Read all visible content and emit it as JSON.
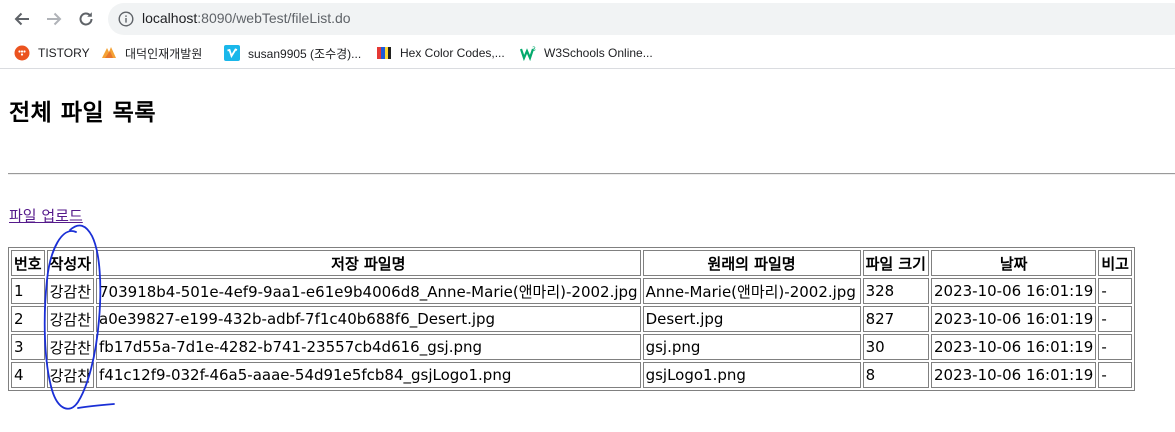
{
  "browser": {
    "url_host": "localhost",
    "url_rest": ":8090/webTest/fileList.do",
    "bookmarks": [
      {
        "label": "TISTORY",
        "icon": "tistory-icon"
      },
      {
        "label": "대덕인재개발원",
        "icon": "ddit-icon"
      },
      {
        "label": "susan9905 (조수경)...",
        "icon": "vimeo-icon"
      },
      {
        "label": "Hex Color Codes,...",
        "icon": "color-book-icon"
      },
      {
        "label": "W3Schools Online...",
        "icon": "w3schools-icon"
      }
    ]
  },
  "page": {
    "title": "전체 파일 목록",
    "upload_link": "파일 업로드",
    "table": {
      "headers": [
        "번호",
        "작성자",
        "저장 파일명",
        "원래의 파일명",
        "파일 크기",
        "날짜",
        "비고"
      ],
      "rows": [
        [
          "1",
          "강감찬",
          "703918b4-501e-4ef9-9aa1-e61e9b4006d8_Anne-Marie(앤마리)-2002.jpg",
          "Anne-Marie(앤마리)-2002.jpg",
          "328",
          "2023-10-06 16:01:19",
          "-"
        ],
        [
          "2",
          "강감찬",
          "a0e39827-e199-432b-adbf-7f1c40b688f6_Desert.jpg",
          "Desert.jpg",
          "827",
          "2023-10-06 16:01:19",
          "-"
        ],
        [
          "3",
          "강감찬",
          "fb17d55a-7d1e-4282-b741-23557cb4d616_gsj.png",
          "gsj.png",
          "30",
          "2023-10-06 16:01:19",
          "-"
        ],
        [
          "4",
          "강감찬",
          "f41c12f9-032f-46a5-aaae-54d91e5fcb84_gsjLogo1.png",
          "gsjLogo1.png",
          "8",
          "2023-10-06 16:01:19",
          "-"
        ]
      ]
    }
  },
  "colors": {
    "annotation_ink": "#1a2fd6",
    "link_visited": "#551a8b"
  }
}
